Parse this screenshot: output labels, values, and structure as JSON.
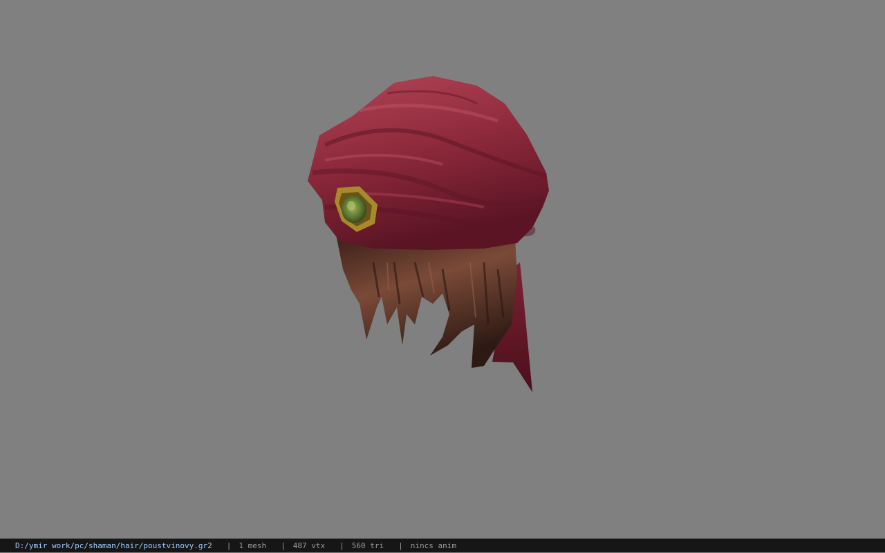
{
  "viewport": {
    "background_color": "#808080",
    "model_subject": "red turban with brown hair and green jeweled brooch",
    "colors": {
      "turban": "#8e2a3c",
      "turban_light": "#b24556",
      "turban_shadow": "#5a1424",
      "hair": "#5a3226",
      "hair_light": "#7a4a38",
      "hair_dark": "#2e1a14",
      "brooch_gold": "#a88a2c",
      "brooch_gem": "#6f8a3c"
    }
  },
  "status_bar": {
    "file_path": "D:/ymir work/pc/shaman/hair/poustvinovy.gr2",
    "separator": "|",
    "mesh_count": "1 mesh",
    "vertex_count": "487 vtx",
    "triangle_count": "560 tri",
    "animation": "nincs anim"
  }
}
